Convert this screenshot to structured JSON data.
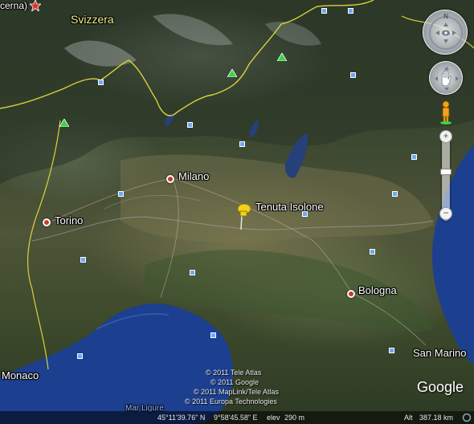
{
  "places": {
    "svizzera": "Svizzera",
    "milano": "Milano",
    "torino": "Torino",
    "tenuta": "Tenuta Isolone",
    "bologna": "Bologna",
    "monaco": "Monaco",
    "san_marino": "San Marino",
    "mar_ligure": "Mar Ligure",
    "top_left_fragment": "cerna)"
  },
  "credits": [
    "© 2011 Tele Atlas",
    "© 2011 Google",
    "© 2011 MapLink/Tele Atlas",
    "© 2011 Europa Technologies"
  ],
  "status_bar": {
    "latitude": "45°11'39.76\" N",
    "longitude": "9°58'45.58\" E",
    "elev_label": "elev",
    "elevation": "290 m",
    "alt_label": "Alt",
    "altitude": "387.18 km"
  },
  "logo": "Google",
  "zoom": {
    "plus": "+",
    "minus": "−"
  },
  "colors": {
    "city_marker": "#c63a2a",
    "pushpin": "#f2d21a",
    "border_line": "#d8d23a",
    "sea": "#1c3f8f",
    "country_label": "#f4f08a",
    "sea_label": "#8fb6ff"
  },
  "icons": {
    "city": "red-dot-icon",
    "placemark": "yellow-pushpin-icon",
    "peak": "green-triangle-icon",
    "poi": "blue-square-icon",
    "capital": "red-star-icon"
  }
}
